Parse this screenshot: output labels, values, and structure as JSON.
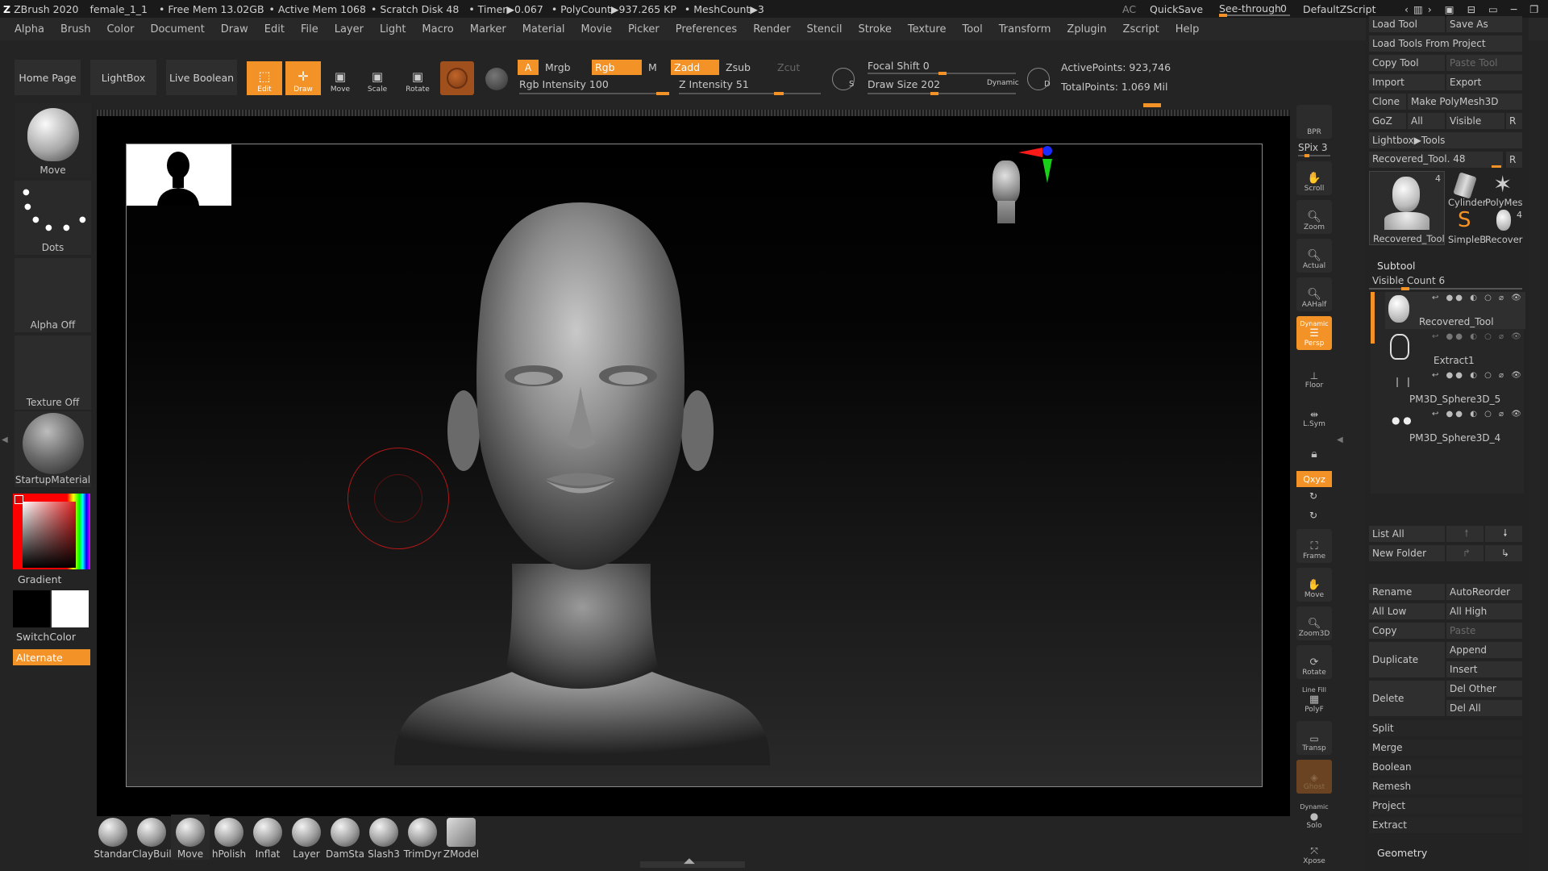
{
  "titlebar": {
    "app": "ZBrush 2020",
    "file": "female_1_1",
    "free_mem": "• Free Mem 13.02GB",
    "active_mem": "• Active Mem 1068",
    "scratch": "• Scratch Disk 48",
    "timer": "• Timer▶0.067",
    "polycount": "• PolyCount▶937.265 KP",
    "meshcount": "• MeshCount▶3",
    "ac": "AC",
    "quicksave": "QuickSave",
    "see_through": "See-through",
    "see_through_val": "0",
    "script": "DefaultZScript"
  },
  "menu": [
    "Alpha",
    "Brush",
    "Color",
    "Document",
    "Draw",
    "Edit",
    "File",
    "Layer",
    "Light",
    "Macro",
    "Marker",
    "Material",
    "Movie",
    "Picker",
    "Preferences",
    "Render",
    "Stencil",
    "Stroke",
    "Texture",
    "Tool",
    "Transform",
    "Zplugin",
    "Zscript",
    "Help"
  ],
  "shelf": {
    "home": "Home Page",
    "lightbox": "LightBox",
    "live_boolean": "Live Boolean",
    "edit": "Edit",
    "draw": "Draw",
    "move": "Move",
    "scale": "Scale",
    "rotate": "Rotate",
    "a": "A",
    "mrgb": "Mrgb",
    "rgb": "Rgb",
    "m": "M",
    "zadd": "Zadd",
    "zsub": "Zsub",
    "zcut": "Zcut",
    "rgb_intensity": "Rgb Intensity 100",
    "z_intensity": "Z Intensity 51",
    "focal_shift": "Focal Shift 0",
    "draw_size": "Draw Size 202",
    "dynamic": "Dynamic",
    "active_points": "ActivePoints: 923,746",
    "total_points": "TotalPoints: 1.069 Mil",
    "s": "S",
    "d": "D"
  },
  "left_panel": {
    "move": "Move",
    "dots": "Dots",
    "alpha_off": "Alpha Off",
    "texture_off": "Texture Off",
    "material": "StartupMaterial",
    "gradient": "Gradient",
    "switchcolor": "SwitchColor",
    "alternate": "Alternate"
  },
  "right_icons": {
    "bpr": "BPR",
    "spix": "SPix 3",
    "scroll": "Scroll",
    "zoom": "Zoom",
    "actual": "Actual",
    "aahalf": "AAHalf",
    "persp_dyn": "Dynamic",
    "persp": "Persp",
    "floor": "Floor",
    "lsym": "L.Sym",
    "xyz": "Qxyz",
    "frame": "Frame",
    "move": "Move",
    "zoom3d": "Zoom3D",
    "rotate": "Rotate",
    "linefill": "Line Fill",
    "polyf": "PolyF",
    "transp": "Transp",
    "ghost": "Ghost",
    "solo_dyn": "Dynamic",
    "solo": "Solo",
    "xpose": "Xpose"
  },
  "tool_palette": {
    "load_tool": "Load Tool",
    "save_as": "Save As",
    "load_from_project": "Load Tools From Project",
    "copy_tool": "Copy Tool",
    "paste_tool": "Paste Tool",
    "import": "Import",
    "export": "Export",
    "clone": "Clone",
    "make_polymesh": "Make PolyMesh3D",
    "goz": "GoZ",
    "all": "All",
    "visible": "Visible",
    "r": "R",
    "lightbox_tools": "Lightbox▶Tools",
    "recovered_tool": "Recovered_Tool. 48",
    "thumbs": [
      {
        "label": "Recovered_Tool",
        "count": "4"
      },
      {
        "label": "Cylinder"
      },
      {
        "label": "PolyMes"
      },
      {
        "label": "SimpleB"
      },
      {
        "label": "Recover",
        "count": "4"
      }
    ],
    "subtool_title": "Subtool",
    "visible_count": "Visible Count 6",
    "subtools": [
      "Recovered_Tool",
      "Extract1",
      "PM3D_Sphere3D_5",
      "PM3D_Sphere3D_4"
    ],
    "list_all": "List All",
    "new_folder": "New Folder",
    "rename": "Rename",
    "autoreorder": "AutoReorder",
    "all_low": "All Low",
    "all_high": "All High",
    "copy": "Copy",
    "paste": "Paste",
    "duplicate": "Duplicate",
    "append": "Append",
    "insert": "Insert",
    "delete": "Delete",
    "del_other": "Del Other",
    "del_all": "Del All",
    "split": "Split",
    "merge": "Merge",
    "boolean": "Boolean",
    "remesh": "Remesh",
    "project": "Project",
    "extract": "Extract",
    "geometry": "Geometry"
  },
  "brushes": [
    "Standar",
    "ClayBuil",
    "Move",
    "hPolish",
    "Inflat",
    "Layer",
    "DamSta",
    "Slash3",
    "TrimDyr",
    "ZModel"
  ],
  "colors": {
    "accent": "#f39226",
    "brush_ring": "#b01818"
  }
}
